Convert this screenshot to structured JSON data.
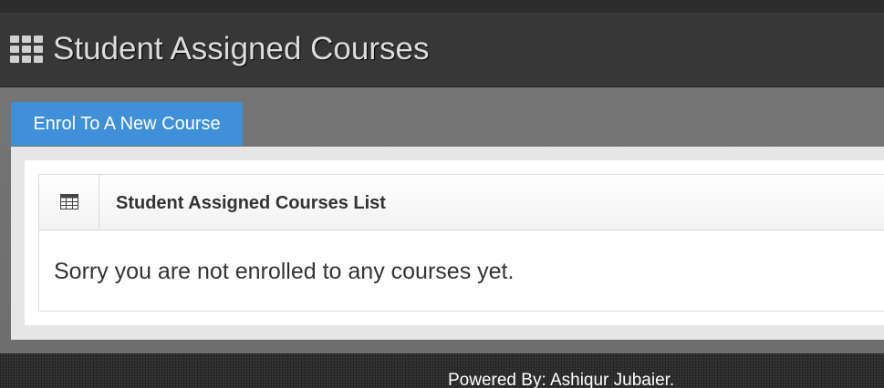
{
  "header": {
    "title": "Student Assigned Courses",
    "icon": "th-grid-icon"
  },
  "actions": {
    "enrol_label": "Enrol To A New Course",
    "accent_color": "#3f90d8"
  },
  "panel": {
    "icon": "table-icon",
    "title": "Student Assigned Courses List",
    "empty_message": "Sorry you are not enrolled to any courses yet."
  },
  "footer": {
    "text": "Powered By: Ashiqur Jubaier."
  }
}
